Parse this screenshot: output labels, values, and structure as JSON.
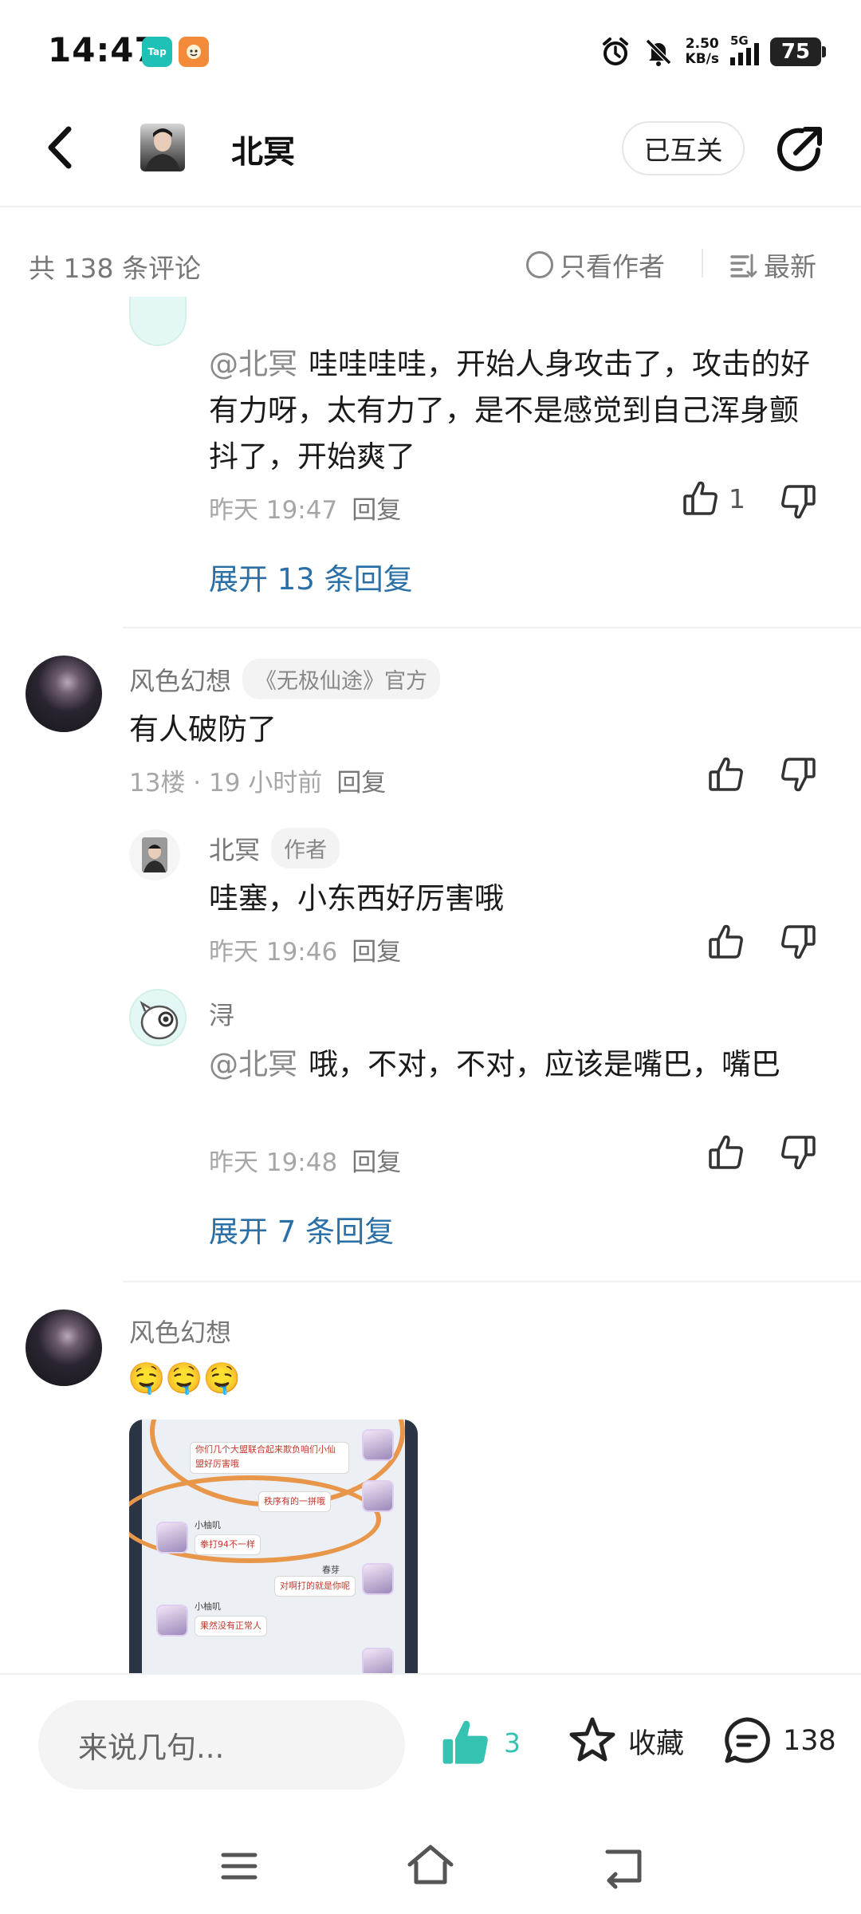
{
  "status_bar": {
    "time": "14:47",
    "net_speed_value": "2.50",
    "net_speed_unit": "KB/s",
    "network": "5G",
    "battery": "75",
    "app_badge_1": "Tap",
    "app_badge_1_color": "#1fc1b7",
    "app_badge_2_color": "#f28a3a"
  },
  "header": {
    "title": "北冥",
    "mutual_label": "已互关"
  },
  "filter_bar": {
    "comment_count": "共 138 条评论",
    "author_only": "只看作者",
    "sort_label": "最新"
  },
  "comments": [
    {
      "reply_text_mention": "@北冥",
      "reply_text": "哇哇哇哇，开始人身攻击了，攻击的好有力呀，太有力了，是不是感觉到自己浑身颤抖了，开始爽了",
      "reply_meta": "昨天 19:47",
      "reply_label": "回复",
      "like_count": "1",
      "expand_label": "展开 13 条回复"
    },
    {
      "name": "风色幻想",
      "tag": "《无极仙途》官方",
      "text": "有人破防了",
      "meta": "13楼 · 19 小时前",
      "reply_label": "回复",
      "replies": [
        {
          "name": "北冥",
          "tag": "作者",
          "text": "哇塞，小东西好厉害哦",
          "meta": "昨天 19:46",
          "reply_label": "回复"
        },
        {
          "name": "浔",
          "mention": "@北冥",
          "text": "哦，不对，不对，应该是嘴巴，嘴巴",
          "meta": "昨天 19:48",
          "reply_label": "回复"
        }
      ],
      "expand_label": "展开 7 条回复"
    },
    {
      "name": "风色幻想",
      "emoji": "🤤🤤🤤",
      "image": {
        "lines": [
          "你们几个大盟联合起来欺负咱们小仙盟好厉害哦",
          "秩序有的一拼哦",
          "拳打94不一样",
          "对啊打的就是你呢",
          "果然没有正常人"
        ],
        "names": [
          "春芽",
          "小柚叽"
        ]
      }
    }
  ],
  "bottom_bar": {
    "input_placeholder": "来说几句...",
    "like_count": "3",
    "favorite_label": "收藏",
    "comment_count": "138"
  },
  "colors": {
    "accent_teal": "#35c2b0",
    "link_blue": "#2a6fa6"
  }
}
